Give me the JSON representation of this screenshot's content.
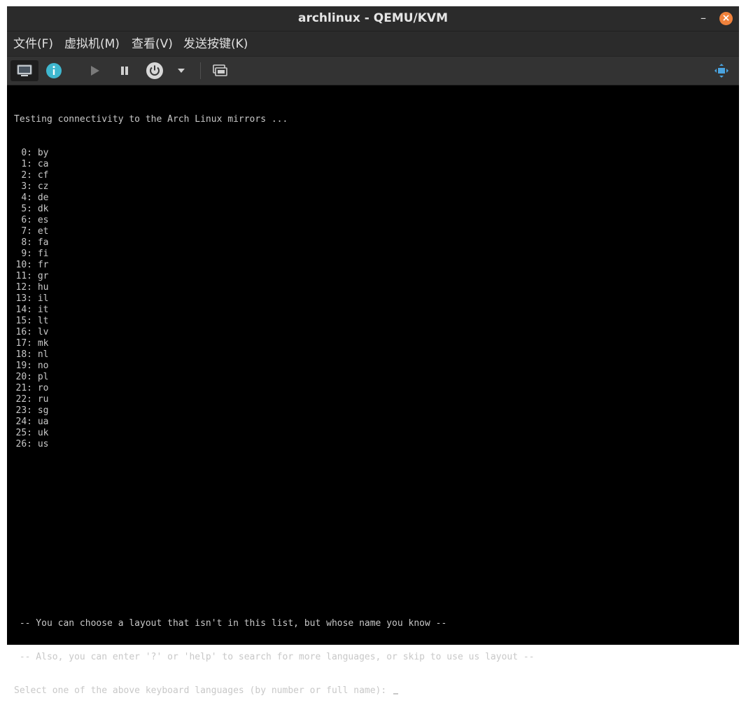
{
  "window": {
    "title": "archlinux - QEMU/KVM",
    "minimize_label": "–",
    "close_label": "×"
  },
  "menubar": {
    "items": [
      "文件(F)",
      "虚拟机(M)",
      "查看(V)",
      "发送按键(K)"
    ]
  },
  "toolbar": {
    "buttons": [
      "console-icon",
      "info-icon",
      "run-icon",
      "pause-icon",
      "power-icon",
      "dropdown-arrow-icon",
      "screenshot-icon",
      "fullscreen-icon"
    ],
    "accent": "#f0823c"
  },
  "terminal": {
    "header": "Testing connectivity to the Arch Linux mirrors ...",
    "layouts": [
      {
        "n": "0:",
        "code": "by"
      },
      {
        "n": "1:",
        "code": "ca"
      },
      {
        "n": "2:",
        "code": "cf"
      },
      {
        "n": "3:",
        "code": "cz"
      },
      {
        "n": "4:",
        "code": "de"
      },
      {
        "n": "5:",
        "code": "dk"
      },
      {
        "n": "6:",
        "code": "es"
      },
      {
        "n": "7:",
        "code": "et"
      },
      {
        "n": "8:",
        "code": "fa"
      },
      {
        "n": "9:",
        "code": "fi"
      },
      {
        "n": "10:",
        "code": "fr"
      },
      {
        "n": "11:",
        "code": "gr"
      },
      {
        "n": "12:",
        "code": "hu"
      },
      {
        "n": "13:",
        "code": "il"
      },
      {
        "n": "14:",
        "code": "it"
      },
      {
        "n": "15:",
        "code": "lt"
      },
      {
        "n": "16:",
        "code": "lv"
      },
      {
        "n": "17:",
        "code": "mk"
      },
      {
        "n": "18:",
        "code": "nl"
      },
      {
        "n": "19:",
        "code": "no"
      },
      {
        "n": "20:",
        "code": "pl"
      },
      {
        "n": "21:",
        "code": "ro"
      },
      {
        "n": "22:",
        "code": "ru"
      },
      {
        "n": "23:",
        "code": "sg"
      },
      {
        "n": "24:",
        "code": "ua"
      },
      {
        "n": "25:",
        "code": "uk"
      },
      {
        "n": "26:",
        "code": "us"
      }
    ],
    "hint1": " -- You can choose a layout that isn't in this list, but whose name you know --",
    "hint2": " -- Also, you can enter '?' or 'help' to search for more languages, or skip to use us layout --",
    "prompt": "Select one of the above keyboard languages (by number or full name): "
  }
}
